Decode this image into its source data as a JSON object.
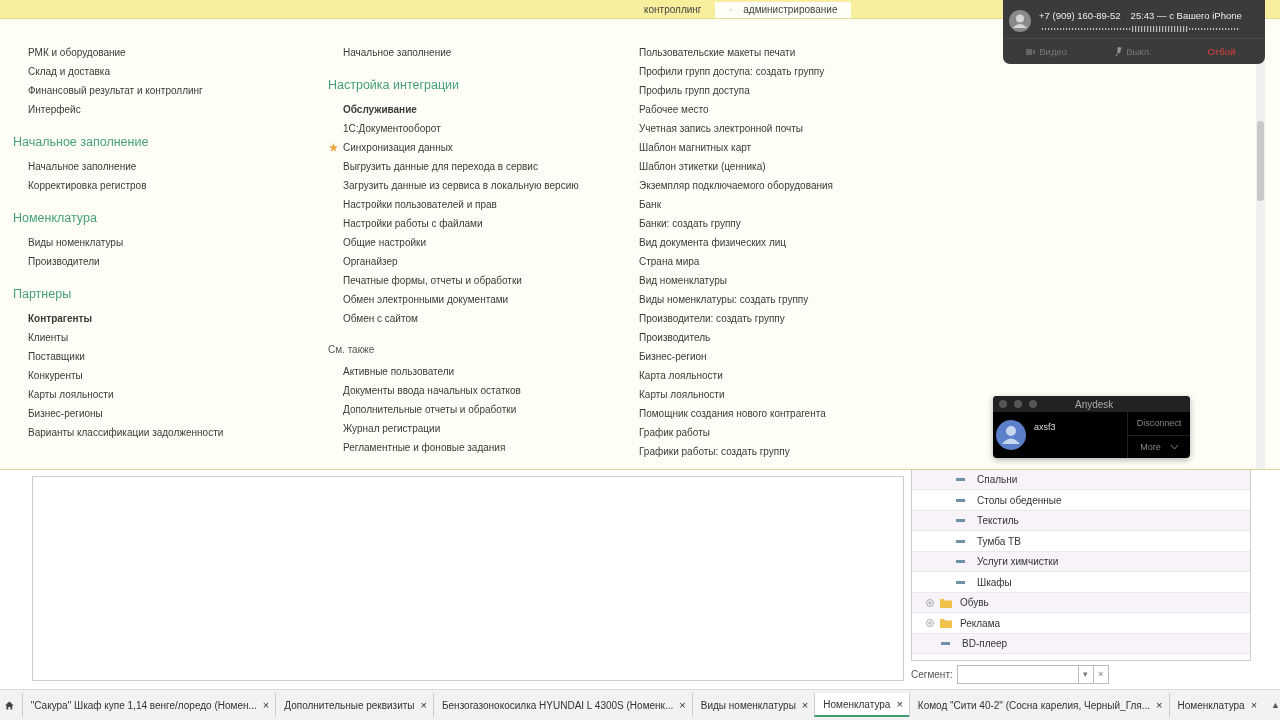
{
  "top_tabs": [
    {
      "label": "контроллинг",
      "selected": false
    },
    {
      "label": "администрирование",
      "selected": true
    }
  ],
  "columns": [
    {
      "groups": [
        {
          "items": [
            {
              "label": "РМК и оборудование",
              "bold": false,
              "starred": false
            },
            {
              "label": "Склад и доставка",
              "bold": false,
              "starred": false
            },
            {
              "label": "Финансовый результат и контроллинг",
              "bold": false,
              "starred": false
            },
            {
              "label": "Интерфейс",
              "bold": false,
              "starred": false
            }
          ]
        },
        {
          "heading": "Начальное заполнение",
          "kind": "section",
          "items": [
            {
              "label": "Начальное заполнение",
              "bold": false,
              "starred": false
            },
            {
              "label": "Корректировка регистров",
              "bold": false,
              "starred": false
            }
          ]
        },
        {
          "heading": "Номенклатура",
          "kind": "section",
          "items": [
            {
              "label": "Виды номенклатуры",
              "bold": false,
              "starred": false
            },
            {
              "label": "Производители",
              "bold": false,
              "starred": false
            }
          ]
        },
        {
          "heading": "Партнеры",
          "kind": "section",
          "items": [
            {
              "label": "Контрагенты",
              "bold": true,
              "starred": false
            },
            {
              "label": "Клиенты",
              "bold": false,
              "starred": false
            },
            {
              "label": "Поставщики",
              "bold": false,
              "starred": false
            },
            {
              "label": "Конкуренты",
              "bold": false,
              "starred": false
            },
            {
              "label": "Карты лояльности",
              "bold": false,
              "starred": false
            },
            {
              "label": "Бизнес-регионы",
              "bold": false,
              "starred": false
            },
            {
              "label": "Варианты классификации задолженности",
              "bold": false,
              "starred": false
            }
          ]
        }
      ]
    },
    {
      "groups": [
        {
          "items": [
            {
              "label": "Начальное заполнение",
              "bold": false,
              "starred": false
            }
          ]
        },
        {
          "heading": "Настройка интеграции",
          "kind": "section",
          "items": [
            {
              "label": "Обслуживание",
              "bold": true,
              "starred": false
            },
            {
              "label": "1С:Документооборот",
              "bold": false,
              "starred": false
            },
            {
              "label": "Синхронизация данных",
              "bold": false,
              "starred": true
            },
            {
              "label": "Выгрузить данные для перехода в сервис",
              "bold": false,
              "starred": false
            },
            {
              "label": "Загрузить данные из сервиса в локальную версию",
              "bold": false,
              "starred": false
            },
            {
              "label": "Настройки пользователей и прав",
              "bold": false,
              "starred": false
            },
            {
              "label": "Настройки работы с файлами",
              "bold": false,
              "starred": false
            },
            {
              "label": "Общие настройки",
              "bold": false,
              "starred": false
            },
            {
              "label": "Органайзер",
              "bold": false,
              "starred": false
            },
            {
              "label": "Печатные формы, отчеты и обработки",
              "bold": false,
              "starred": false
            },
            {
              "label": "Обмен электронными документами",
              "bold": false,
              "starred": false
            },
            {
              "label": "Обмен с сайтом",
              "bold": false,
              "starred": false
            }
          ]
        },
        {
          "heading": "См. также",
          "kind": "see_also",
          "items": [
            {
              "label": "Активные пользователи",
              "bold": false,
              "starred": false
            },
            {
              "label": "Документы ввода начальных остатков",
              "bold": false,
              "starred": false
            },
            {
              "label": "Дополнительные отчеты и обработки",
              "bold": false,
              "starred": false
            },
            {
              "label": "Журнал регистрации",
              "bold": false,
              "starred": false
            },
            {
              "label": "Регламентные и фоновые задания",
              "bold": false,
              "starred": false
            }
          ]
        }
      ]
    },
    {
      "groups": [
        {
          "items": [
            {
              "label": "Пользовательские макеты печати",
              "bold": false,
              "starred": false
            },
            {
              "label": "Профили групп доступа: создать группу",
              "bold": false,
              "starred": false
            },
            {
              "label": "Профиль групп доступа",
              "bold": false,
              "starred": false
            },
            {
              "label": "Рабочее место",
              "bold": false,
              "starred": false
            },
            {
              "label": "Учетная запись электронной почты",
              "bold": false,
              "starred": false
            },
            {
              "label": "Шаблон магнитных карт",
              "bold": false,
              "starred": false
            },
            {
              "label": "Шаблон этикетки (ценника)",
              "bold": false,
              "starred": false
            },
            {
              "label": "Экземпляр подключаемого оборудования",
              "bold": false,
              "starred": false
            },
            {
              "label": "Банк",
              "bold": false,
              "starred": false
            },
            {
              "label": "Банки: создать группу",
              "bold": false,
              "starred": false
            },
            {
              "label": "Вид документа физических лиц",
              "bold": false,
              "starred": false
            },
            {
              "label": "Страна мира",
              "bold": false,
              "starred": false
            },
            {
              "label": "Вид номенклатуры",
              "bold": false,
              "starred": false
            },
            {
              "label": "Виды номенклатуры: создать группу",
              "bold": false,
              "starred": false
            },
            {
              "label": "Производители: создать группу",
              "bold": false,
              "starred": false
            },
            {
              "label": "Производитель",
              "bold": false,
              "starred": false
            },
            {
              "label": "Бизнес-регион",
              "bold": false,
              "starred": false
            },
            {
              "label": "Карта лояльности",
              "bold": false,
              "starred": false
            },
            {
              "label": "Карты лояльности",
              "bold": false,
              "starred": false
            },
            {
              "label": "Помощник создания нового контрагента",
              "bold": false,
              "starred": false
            },
            {
              "label": "График работы",
              "bold": false,
              "starred": false
            },
            {
              "label": "Графики работы: создать группу",
              "bold": false,
              "starred": false
            }
          ]
        }
      ]
    }
  ],
  "call": {
    "number": "+7 (909) 160-89-52",
    "status": "25:43 — с Вашего iPhone",
    "buttons": [
      {
        "label": "Видео",
        "kind": "video"
      },
      {
        "label": "Выкл.",
        "kind": "mute"
      },
      {
        "label": "Отбой",
        "kind": "end"
      }
    ]
  },
  "anydesk": {
    "title": "Anydesk",
    "user": "axsf3",
    "disconnect": "Disconnect",
    "more": "More"
  },
  "tree": [
    {
      "label": "Спальни",
      "kind": "leaf"
    },
    {
      "label": "Столы обеденные",
      "kind": "leaf"
    },
    {
      "label": "Текстиль",
      "kind": "leaf"
    },
    {
      "label": "Тумба ТВ",
      "kind": "leaf"
    },
    {
      "label": "Услуги химчистки",
      "kind": "leaf"
    },
    {
      "label": "Шкафы",
      "kind": "leaf"
    },
    {
      "label": "Обувь",
      "kind": "folder"
    },
    {
      "label": "Реклама",
      "kind": "folder"
    },
    {
      "label": "BD-плеер",
      "kind": "element"
    }
  ],
  "segment": {
    "label": "Сегмент:",
    "dropdown": "▾",
    "clear": "×"
  },
  "taskbar": [
    {
      "label": "\"Сакура\" Шкаф купе 1,14  венге/лоредо (Номен...",
      "selected": false
    },
    {
      "label": "Дополнительные реквизиты",
      "selected": false
    },
    {
      "label": "Бензогазонокосилка HYUNDAI L 4300S (Номенк...",
      "selected": false
    },
    {
      "label": "Виды номенклатуры",
      "selected": false
    },
    {
      "label": "Номенклатура",
      "selected": true
    },
    {
      "label": "Комод \"Сити 40-2\" (Сосна карелия, Черный_Гля...",
      "selected": false
    },
    {
      "label": "Номенклатура",
      "selected": false
    }
  ],
  "taskbar_close": "×",
  "taskbar_scroll": "▲"
}
